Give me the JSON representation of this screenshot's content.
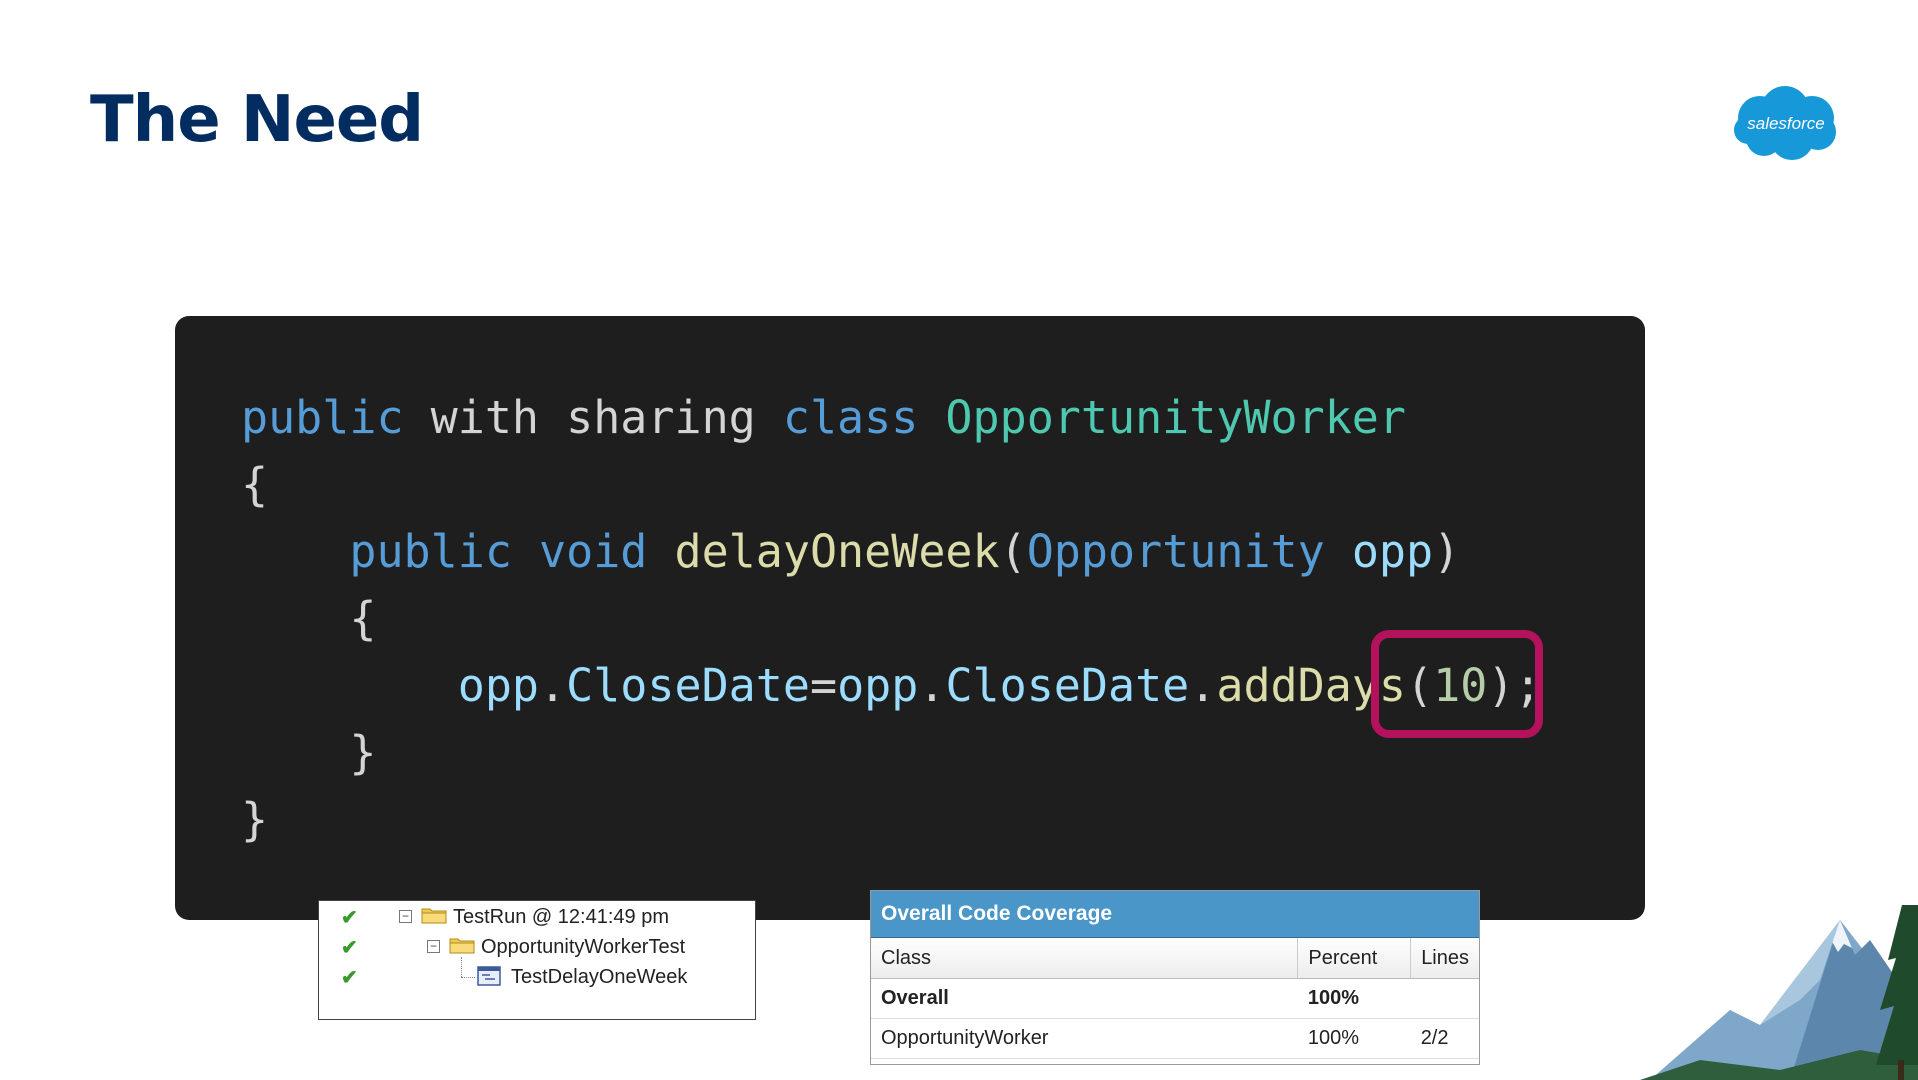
{
  "slide": {
    "title": "The Need",
    "logo_text": "salesforce",
    "brand_color": "#032d60",
    "logo_color": "#1798d8"
  },
  "code": {
    "highlight_color": "#b5125e",
    "lines": [
      [
        {
          "t": "public",
          "c": "kw"
        },
        {
          "t": " with sharing ",
          "c": "pl"
        },
        {
          "t": "class",
          "c": "kw"
        },
        {
          "t": " ",
          "c": "pl"
        },
        {
          "t": "OpportunityWorker",
          "c": "typ"
        }
      ],
      [
        {
          "t": "{",
          "c": "pl"
        }
      ],
      [
        {
          "t": "    ",
          "c": "pl"
        },
        {
          "t": "public",
          "c": "kw"
        },
        {
          "t": " ",
          "c": "pl"
        },
        {
          "t": "void",
          "c": "kw"
        },
        {
          "t": " ",
          "c": "pl"
        },
        {
          "t": "delayOneWeek",
          "c": "fn"
        },
        {
          "t": "(",
          "c": "pl"
        },
        {
          "t": "Opportunity",
          "c": "kw"
        },
        {
          "t": " ",
          "c": "pl"
        },
        {
          "t": "opp",
          "c": "var"
        },
        {
          "t": ")",
          "c": "pl"
        }
      ],
      [
        {
          "t": "    {",
          "c": "pl"
        }
      ],
      [
        {
          "t": "        ",
          "c": "pl"
        },
        {
          "t": "opp",
          "c": "var"
        },
        {
          "t": ".",
          "c": "pl"
        },
        {
          "t": "CloseDate",
          "c": "var"
        },
        {
          "t": "=",
          "c": "pl"
        },
        {
          "t": "opp",
          "c": "var"
        },
        {
          "t": ".",
          "c": "pl"
        },
        {
          "t": "CloseDate",
          "c": "var"
        },
        {
          "t": ".",
          "c": "pl"
        },
        {
          "t": "addDays",
          "c": "fn"
        },
        {
          "t": "(",
          "c": "pl"
        },
        {
          "t": "10",
          "c": "num"
        },
        {
          "t": ");",
          "c": "pl"
        }
      ],
      [
        {
          "t": "    }",
          "c": "pl"
        }
      ],
      [
        {
          "t": "}",
          "c": "pl"
        }
      ]
    ]
  },
  "test_tree": {
    "status_icon": "check-icon",
    "run": {
      "label": "TestRun @ 12:41:49 pm",
      "icon": "folder-icon"
    },
    "test_class": {
      "label": "OpportunityWorkerTest",
      "icon": "folder-icon"
    },
    "test_method": {
      "label": "TestDelayOneWeek",
      "icon": "method-icon"
    }
  },
  "coverage": {
    "header": "Overall Code Coverage",
    "header_color": "#4a96c8",
    "columns": [
      "Class",
      "Percent",
      "Lines"
    ],
    "rows": [
      {
        "class": "Overall",
        "percent": "100%",
        "lines": ""
      },
      {
        "class": "OpportunityWorker",
        "percent": "100%",
        "lines": "2/2"
      }
    ]
  }
}
